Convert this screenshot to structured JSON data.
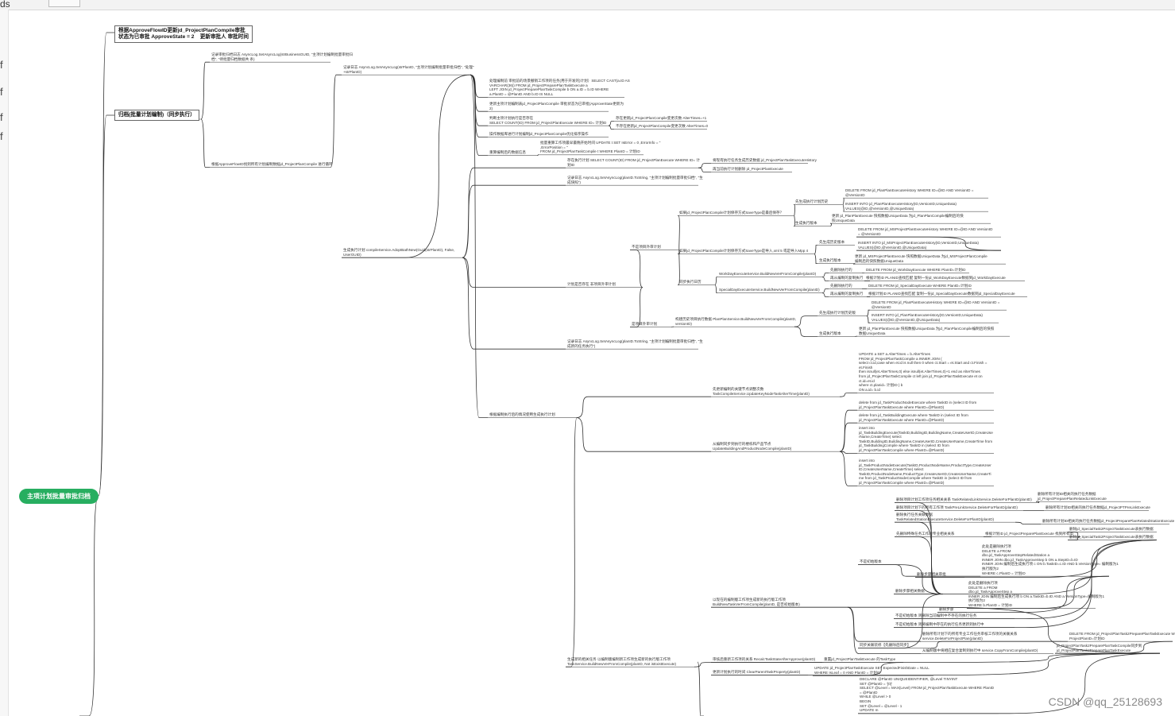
{
  "topbar": {
    "fragment": "ds"
  },
  "sidebar_fragments": [
    "f",
    "f",
    "f",
    "f"
  ],
  "mindmap": {
    "root": "主项计划批量审批归档",
    "branches": [
      "根据ApproveFlowID更新jd_ProjectPlanCompile审批\n状态为已审批 ApproveState = 2    更新审批人 审批时间",
      "归档(批量计划编制)（同步执行）"
    ],
    "nodes": [
      "记录审批归档日志 AsyncLog.SetAsyncLog(strBusinessGUID, \"主项计划编制批量审批归\n档\", \"待批量归档数据共 条)",
      "根据ApproveFlowID找到所有计划编制数据jd_ProjectPlanCompile 进行循环",
      "记录日志 AsyncLog.SetAsyncLog(strPlanID, \"主项计划编制批量审批归档\", \"处理\"\n+strPlanID)",
      "处理编制前 审批前的场景撤销工作项的任务(用于开发的)计划）SELECT CAST(a.ID AS\nVARCHAR(36)) FROM jd_ProjectPreparePlanTaskExecute a\nLEFT JOIN jd_ProjectPreparePlanTaskCompile b ON a.ID = b.ID WHERE\na.PlanID = @PlanID AND b.ID IS NULL",
      "更新主项计划编制表jd_ProjectPlanCompile 审批状态为已审批(ApproveState更新为\n2)",
      "判断主项计划执行是否存在\nSELECT COUNT(ID) FROM jd_ProjectPlanExecute WHERE ID= 计划ID",
      "存在更新jd_ProjectPlanCompile变更次数 AlterTimes=+1",
      "不存在更新jd_ProjectPlanCompile变更次数 AlterTimes=0",
      "操作数据库进行计划编制jd_ProjectPlanCompile优化排序操作",
      "重算编制后的数据信息",
      "批量重算工作项最早最晚开始时间 UPDATE t SET IsError = 0 ,ErrorInfo = ''\n,ErrorPosition = ''\nFROM jd_ProjectPlanTaskCompile t WHERE PlanID = 计划ID",
      "生成执行计划 compileService.AdoptBathNew(Guid(strPlanID), False,\nUserGUID)",
      "存在执行计划 SELECT COUNT(ID) FROM jd_ProjectPlanExecute WHERE ID= 计\n划ID",
      "将现有执行任务生成历史数据 jd_ProjectPlanTaskExecuteHistory",
      "再当前执行计划删除 jd_ProjectPlanExecute",
      "记录日志 AsyncLog.SetAsyncLog(planID.ToString, \"主项计划编制批量审批归档\", \"生\n成快照\")",
      "计划是否存在 非项目外审计划",
      "不是项目外审计划",
      "如果jd_ProjectPlanCompile计划保存方式SaveType是最后保存？",
      "先生成执行计划历史",
      "DELETE FROM jd_PlanPlanExecuteHistory WHERE ID=@ID AND VersionID =\n@VersionID",
      "INSERT INTO jd_PlanPlanExecuteHistory(ID,VersionID,UniqueData)\nVALUES(@ID,@VersionID,@UniqueData)",
      "生成执行版本",
      "更新 jd_PlanPlanExecute 快照数据UniqueData 为jd_PlanPlanCompile编制后的快\n照UniqueData",
      "如果jd_ProjectPlanCompile计划保存方式SaveType是导入,xml 5 或是导入Mpp 4",
      "DELETE FROM jd_MSProjectPlanExecuteHistory WHERE ID=@ID AND VersionID\n= @VersionID",
      "先生成历史版本",
      "INSERT INTO jd_MSProjectPlanExecuteHistory(ID,VersionID,UniqueData)\nVALUES(@ID,@VersionID,@UniqueData)",
      "生成执行版本",
      "更新 jd_MSProjectPlanExecute 快照数据UniqueData 为jd_MSProjectPlanCompile\n编制后的快照数据UniqueData",
      "同步执行日历",
      "WorkDayExecuteService.BuildNewVerFromCompile(planID)",
      "先删除执行的",
      "DELETE FROM jd_WorkDayExecute WHERE PlanID=计划ID",
      "再从编制的复制执行",
      "根据计划ID PLANID查找匹配 复制一份jd_WorkDayExecute数据到jd_WorkDayExecute",
      "SpecialDayExecuteService.BuildNewVerFromCompile(planID)",
      "先删除执行的",
      "DELETE FROM jd_SpecialDayExecute WHERE PlanID=计划ID",
      "再从编制的复制执行",
      "根据计划ID PLANID查找匹配 复制一份jd_SpecialDayExecute数据到jd_SpecialDayExecute",
      "是项目外审计划",
      "构建历史项目执行数据 PlanPlanService.BuildNewVerFromCompile(planID,\nversionID)",
      "DELETE FROM jd_PlanPlanExecuteHistory WHERE ID=@ID AND VersionID =\n@VersionID",
      "先生成执行计划历史版",
      "INSERT INTO jd_PlanPlanExecuteHistory(ID,VersionID,UniqueData)\nVALUES(@ID,@VersionID,@UniqueData)",
      "生成执行版本",
      "更新 jd_PlanPlanExecute 快照数据UniqueData 为jd_PlanPlanCompile编制后的快照\n数据UniqueData",
      "记录日志 AsyncLog.SetAsyncLog(planID.ToString, \"主项计划编制批量审批归档\", \"生\n成新的任务执行\")",
      "根据编制执行后的情况使用生成执行计划",
      "先更新编制的关键节点调整次数\nTaskCompileService.UpdateKeyNodeTaskAlterTime(planID)",
      "UPDATE a SET a.AlterTimes = b.AlterTimes\nFROM jd_ProjectPlanTaskCompile a INNER JOIN (\nselect ct.id,case when et.id is null then 0 when ct.Start = et.Start and ct.Finish =\net.Finish\nthen isnull(et.AlterTimes,0) else isnull(et.AlterTimes,0)+1 end as AlterTimes\nfrom jd_ProjectPlanTaskCompile ct left join jd_ProjectPlanTaskExecute et on\nct.id=et.id\nwhere ct.planid= 计划ID ) b\nON a.id= b.id",
      "从编制同步到执行的楼栋和产品节点\nUpdateBuildingAndProductNodeCompile(planID)",
      "delete from jd_TaskProductNodeExecute where TaskID in (select ID from\njd_ProjectPlanTaskExecute where PlanID=@PlanID)",
      "delete from jd_TaskBuildingExecute where TaskID in (select ID from\njd_ProjectPlanTaskExecute where PlanID=@PlanID)",
      "insert into\njd_TaskBuildingExecute(TaskID,BuildingID,BuildingName,CreateUserID,CreateUse\nrName,CreateTime) select\nTaskID,BuildingID,BuildingName,CreateUserID,CreateUserName,CreateTime from\njd_TaskBuildingCompile where TaskID in (select ID from\njd_ProjectPlanTaskCompile where PlanID=@PlanID)",
      "insert into\njd_TaskProductNodeExecute(TaskID,ProductNodeName,ProductType,CreateUser\nID,CreateUserName,CreateTime) select\nTaskID,ProductNodeName,ProductType,CreateUserID,CreateUserName,CreateTi\nme from jd_TaskProductNodeCompile where TaskID in (select ID from\njd_ProjectPlanTaskCompile where PlanID=@PlanID)",
      "删除项目计划工作项任务相关关系 TaskRelatedLinkService.DeleteForPlanID(planID)",
      "删除所有计划ID相关的执行任务数据\njd_ProjectPreparePlanRelatedLinkExecute",
      "删除项目计划下的所有工作项 TaskPreLinkService.DeleteForPlanID(planID)",
      "删除所有计划ID相关的执行任务数据jd_ProjectPTPreLinkExecute",
      "删除执行任务关联数据\nTaskRelatedStationExecuteService.DeleteForPlanID(planID)",
      "删除所有计划ID相关的执行任务数据jd_ProjectPreparePlanRelatedStationExecute",
      "先删除特殊任务工作项专业相关关系",
      "根据计划ID jd_ProjectPreparePlanExecute 找到所有ID",
      "删除jd_SpecialTask2ProjectTaskExecute表执行数据",
      "删除jd_SpecialTask2ProjectTaskExecute表执行数据",
      "不是初始版本",
      "删除步骤相关审批",
      "此处是删除执行项\nDELETE a FROM\ndbo.jd_TaskApproveStepRelatedStation a\nINNER JOIN dbo.jd_TaskApproveStep b ON a.StepID=b.ID\nINNER JOIN 编制后生成执行项 c ON b.TaskID=c.ID AND b.VersionType= 编制版为1\n执行版为2\nWHERE c.PlanID = 计划ID",
      "删除步骤相关数据",
      "删除步骤",
      "此处是删除执行项\nDELETE a FROM\ndbo.jd_TaskApproveStep a\nINNER JOIN 编制后生成执行项 b ON a.TaskID=b.ID AND a.VersionType=编制版为1\n执行版为2\nWHERE b.PlanID = 计划ID",
      "不是初始版本 则删除当前编制中不存在的执行任务",
      "不是初始版本 则将编制中存在的执行任务更新到执行中",
      "以现在的编制版工作项生成新的执行版工作项\nBuildNewTaskVerFromCompile(planID, 是否初始版本)",
      "同步关联装修【先删除后同步】",
      "删除所有计划下的所有专业工作任务审核工作项的关联关系\nservice.DeleteForProjectPlan(planID)",
      "DELETE FROM jd_ProjectPlanTask2PreparePlanTaskExecute WHERE\nProjectPlanID=计划ID",
      "从编制版中将相应复合复制到执行中 service.CopyFromCompile(planID)",
      "jd_ProjectPlanTask2PreparePlanTaskCompile同步到\njd_ProjectPlanTask2PreparePlanTaskExecute",
      "生成新的相关任务 以编制版编制新工作项生成新的执行版工作项\nTaskService.BuildNewVerFromCompile(planID, Not isExistExecute)",
      "审核后重新工作项的关系 RecalcTaskStateAfterApprove(planID)",
      "重置jd_ProjectPlanTaskExecute 的TaskType",
      "更新计划执行的时间 ClearParentTaskProperty(planID)",
      "UPDATE jd_ProjectPlanTaskExecute SET ExpectedFinishDate = NULL\nWHERE IsLeaf = 0 AND PlanID = 计划ID",
      "DECLARE @PlanID UNIQUEIDENTIFIER, @Level TINYINT\nSET @PlanID = '{0}'\nSELECT @Level = MAX(Level) FROM jd_ProjectPlanTaskExecute WHERE PlanID\n= @PlanID\nWHILE @Level > 0\nBEGIN\nSET @Level = @Level - 1\nUPDATE m"
    ]
  },
  "watermark": "CSDN @qq_25128693"
}
